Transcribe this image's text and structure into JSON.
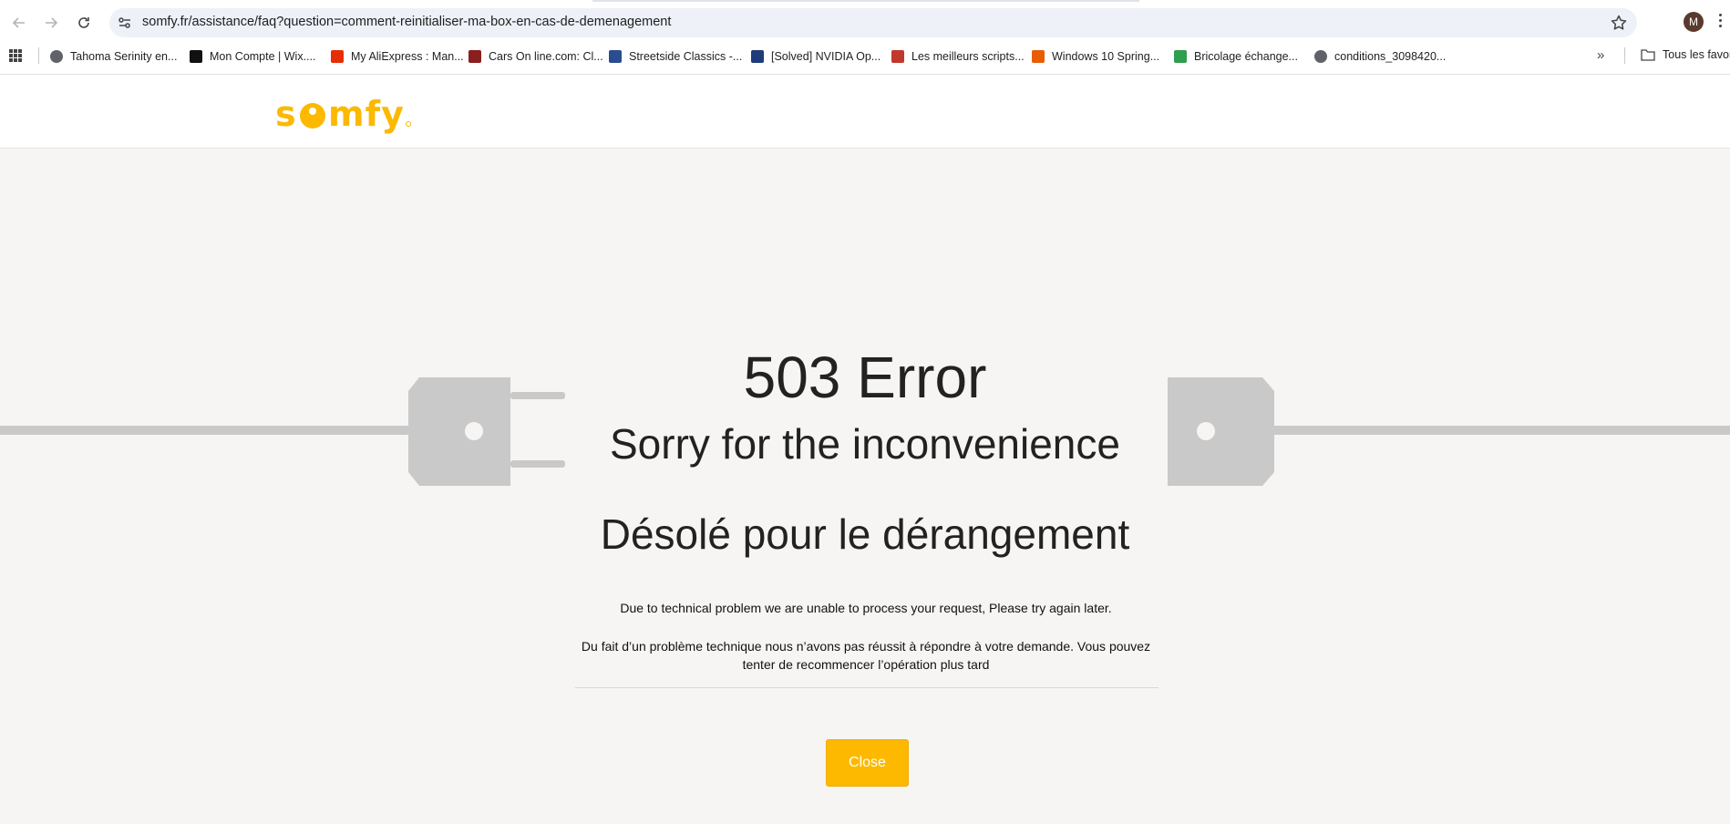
{
  "browser": {
    "url": "somfy.fr/assistance/faq?question=comment-reinitialiser-ma-box-en-cas-de-demenagement",
    "profile_initial": "M",
    "bookmarks": [
      {
        "label": "Tahoma Serinity en...",
        "icon": "globe-icon",
        "color": "#5f6368"
      },
      {
        "label": "Mon Compte | Wix....",
        "icon": "wix-icon",
        "color": "#111111"
      },
      {
        "label": "My AliExpress : Man...",
        "icon": "aliexpress-icon",
        "color": "#e62e04"
      },
      {
        "label": "Cars On line.com: Cl...",
        "icon": "cars-icon",
        "color": "#8b1e1e"
      },
      {
        "label": "Streetside Classics -...",
        "icon": "shield-icon",
        "color": "#2a4d8f"
      },
      {
        "label": "[Solved] NVIDIA Op...",
        "icon": "nvidia-icon",
        "color": "#1f3b7a"
      },
      {
        "label": "Les meilleurs scripts...",
        "icon": "script-icon",
        "color": "#c0392b"
      },
      {
        "label": "Windows 10 Spring...",
        "icon": "windows-icon",
        "color": "#e85d04"
      },
      {
        "label": "Bricolage échange...",
        "icon": "bricolage-icon",
        "color": "#2e9e4f"
      },
      {
        "label": "conditions_3098420...",
        "icon": "globe-icon",
        "color": "#5f6368"
      }
    ],
    "bookmarks_folder": "Tous les favoris"
  },
  "site": {
    "logo_text": "somfy",
    "brand_color": "#fcb900"
  },
  "error": {
    "code_title": "503 Error",
    "subtitle_en": "Sorry for the inconvenience",
    "subtitle_fr": "Désolé pour le dérangement",
    "message_en": "Due to technical problem we are unable to process your request, Please try again later.",
    "message_fr": "Du fait d’un problème technique nous n’avons pas réussit à répondre à votre demande. Vous pouvez tenter de recommencer l’opération plus tard",
    "close_label": "Close"
  }
}
